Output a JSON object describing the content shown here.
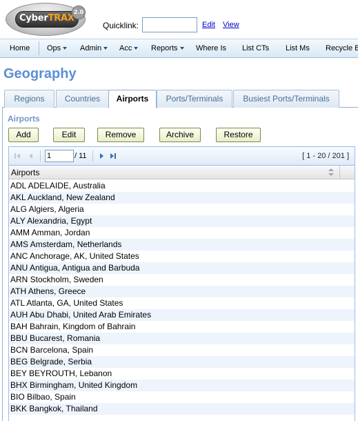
{
  "logo": {
    "word_cyber": "Cyber",
    "word_trax": "TRAX",
    "version": "2.0"
  },
  "header": {
    "quicklink_label": "Quicklink:",
    "quicklink_value": "",
    "edit_link": "Edit",
    "view_link": "View"
  },
  "nav": {
    "items": [
      {
        "label": "Home"
      },
      {
        "label": "Ops"
      },
      {
        "label": "Admin"
      },
      {
        "label": "Acc"
      },
      {
        "label": "Reports"
      },
      {
        "label": "Where Is"
      },
      {
        "label": "List CTs"
      },
      {
        "label": "List Ms"
      },
      {
        "label": "Recycle B"
      }
    ]
  },
  "page": {
    "title": "Geography"
  },
  "tabs": [
    {
      "label": "Regions"
    },
    {
      "label": "Countries"
    },
    {
      "label": "Airports",
      "active": true
    },
    {
      "label": "Ports/Terminals"
    },
    {
      "label": "Busiest Ports/Terminals"
    }
  ],
  "panel": {
    "title": "Airports",
    "buttons": {
      "add": "Add",
      "edit": "Edit",
      "remove": "Remove",
      "archive": "Archive",
      "restore": "Restore"
    }
  },
  "pager": {
    "page": "1",
    "of": "/ 11",
    "range": "[ 1 - 20 / 201 ]"
  },
  "grid": {
    "column": "Airports",
    "rows": [
      "ADL ADELAIDE, Australia",
      "AKL Auckland, New Zealand",
      "ALG Algiers, Algeria",
      "ALY Alexandria, Egypt",
      "AMM Amman, Jordan",
      "AMS Amsterdam, Netherlands",
      "ANC Anchorage, AK, United States",
      "ANU Antigua, Antigua and Barbuda",
      "ARN Stockholm, Sweden",
      "ATH Athens, Greece",
      "ATL Atlanta, GA, United States",
      "AUH Abu Dhabi, United Arab Emirates",
      "BAH Bahrain, Kingdom of Bahrain",
      "BBU Bucarest, Romania",
      "BCN Barcelona, Spain",
      "BEG Belgrade, Serbia",
      "BEY BEYROUTH, Lebanon",
      "BHX Birmingham, United Kingdom",
      "BIO Bilbao, Spain",
      "BKK Bangkok, Thailand"
    ]
  },
  "colors": {
    "accent": "#5b8fd6",
    "nav_bg": "#d9e8f5",
    "alt_row": "#edf4fc",
    "logo_orange": "#f7a01f"
  }
}
